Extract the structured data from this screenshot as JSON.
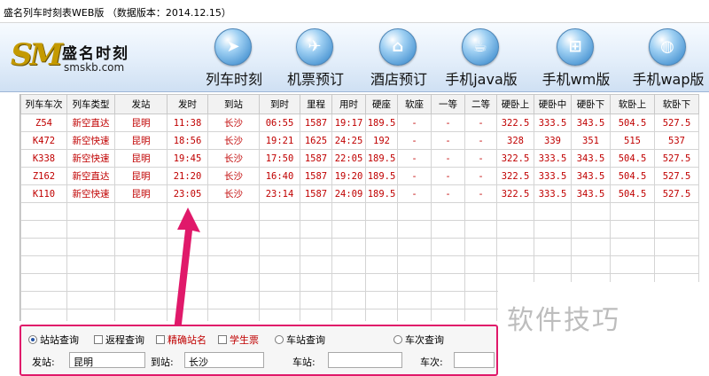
{
  "window": {
    "title": "盛名列车时刻表WEB版  （数据版本：2014.12.15）"
  },
  "logo": {
    "mark": "SM",
    "name": "盛名时刻",
    "url": "smskb.com"
  },
  "nav": [
    {
      "label": "列车时刻",
      "icon": "train-icon",
      "glyph": "➤"
    },
    {
      "label": "机票预订",
      "icon": "airplane-icon",
      "glyph": "✈"
    },
    {
      "label": "酒店预订",
      "icon": "hotel-icon",
      "glyph": "⌂"
    },
    {
      "label": "手机java版",
      "icon": "java-icon",
      "glyph": "☕"
    },
    {
      "label": "手机wm版",
      "icon": "windows-icon",
      "glyph": "⊞"
    },
    {
      "label": "手机wap版",
      "icon": "globe-icon",
      "glyph": "◍"
    }
  ],
  "table": {
    "headers": [
      "列车车次",
      "列车类型",
      "发站",
      "发时",
      "到站",
      "到时",
      "里程",
      "用时",
      "硬座",
      "软座",
      "一等",
      "二等",
      "硬卧上",
      "硬卧中",
      "硬卧下",
      "软卧上",
      "软卧下"
    ],
    "rows": [
      [
        "Z54",
        "新空直达",
        "昆明",
        "11:38",
        "长沙",
        "06:55",
        "1587",
        "19:17",
        "189.5",
        "-",
        "-",
        "-",
        "322.5",
        "333.5",
        "343.5",
        "504.5",
        "527.5"
      ],
      [
        "K472",
        "新空快速",
        "昆明",
        "18:56",
        "长沙",
        "19:21",
        "1625",
        "24:25",
        "192",
        "-",
        "-",
        "-",
        "328",
        "339",
        "351",
        "515",
        "537"
      ],
      [
        "K338",
        "新空快速",
        "昆明",
        "19:45",
        "长沙",
        "17:50",
        "1587",
        "22:05",
        "189.5",
        "-",
        "-",
        "-",
        "322.5",
        "333.5",
        "343.5",
        "504.5",
        "527.5"
      ],
      [
        "Z162",
        "新空直达",
        "昆明",
        "21:20",
        "长沙",
        "16:40",
        "1587",
        "19:20",
        "189.5",
        "-",
        "-",
        "-",
        "322.5",
        "333.5",
        "343.5",
        "504.5",
        "527.5"
      ],
      [
        "K110",
        "新空快速",
        "昆明",
        "23:05",
        "长沙",
        "23:14",
        "1587",
        "24:09",
        "189.5",
        "-",
        "-",
        "-",
        "322.5",
        "333.5",
        "343.5",
        "504.5",
        "527.5"
      ]
    ]
  },
  "query": {
    "station_query": "站站查询",
    "return_query": "返程查询",
    "exact_name": "精确站名",
    "student_ticket": "学生票",
    "station_lookup": "车站查询",
    "train_lookup": "车次查询",
    "from_label": "发站:",
    "from_value": "昆明",
    "to_label": "到站:",
    "to_value": "长沙",
    "station_label": "车站:",
    "station_value": "",
    "train_label": "车次:",
    "train_value": ""
  },
  "watermark": "软件技巧",
  "colors": {
    "accent_red": "#c00000",
    "annotation": "#e0196a"
  }
}
